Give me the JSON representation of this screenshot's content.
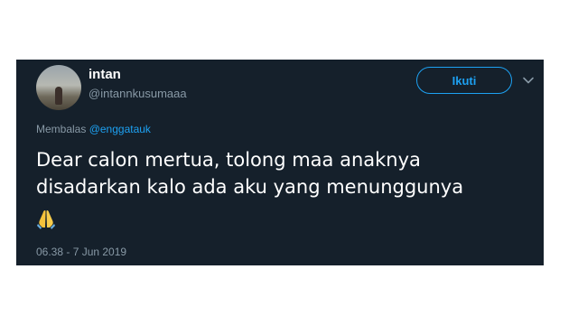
{
  "tweet": {
    "display_name": "intan",
    "username": "@intannkusumaaa",
    "follow_label": "Ikuti",
    "reply_prefix": "Membalas",
    "reply_mention": "@enggatauk",
    "text_line1": "Dear calon mertua, tolong maa anaknya",
    "text_line2": "disadarkan kalo ada aku yang menunggunya",
    "emoji_icon": "folded-hands-icon",
    "timestamp": "06.38 - 7 Jun 2019"
  },
  "colors": {
    "card_background": "#15202b",
    "accent": "#1da1f2",
    "secondary_text": "#8899a6",
    "primary_text": "#ffffff"
  }
}
